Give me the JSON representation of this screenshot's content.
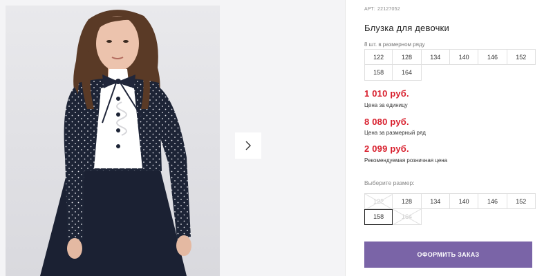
{
  "product": {
    "sku_label": "АРТ:",
    "sku": "22127052",
    "title": "Блузка для девочки",
    "pack_note": "8 шт. в размерном ряду"
  },
  "size_range": [
    "122",
    "128",
    "134",
    "140",
    "146",
    "152",
    "158",
    "164"
  ],
  "prices": {
    "unit_price": "1 010 руб.",
    "unit_label": "Цена за единицу",
    "range_price": "8 080 руб.",
    "range_label": "Цена за размерный ряд",
    "retail_price": "2 099 руб.",
    "retail_label": "Рекомендуемая розничная цена"
  },
  "size_picker": {
    "label": "Выберите размер:",
    "options": [
      {
        "size": "122",
        "available": false,
        "selected": false
      },
      {
        "size": "128",
        "available": true,
        "selected": false
      },
      {
        "size": "134",
        "available": true,
        "selected": false
      },
      {
        "size": "140",
        "available": true,
        "selected": false
      },
      {
        "size": "146",
        "available": true,
        "selected": false
      },
      {
        "size": "152",
        "available": true,
        "selected": false
      },
      {
        "size": "158",
        "available": true,
        "selected": true
      },
      {
        "size": "164",
        "available": false,
        "selected": false
      }
    ]
  },
  "order_button": "ОФОРМИТЬ ЗАКАЗ",
  "colors": {
    "price": "#d81e2c",
    "button": "#7a64a7",
    "dress": "#1d2436"
  },
  "icons": {
    "next": "chevron-right-icon"
  }
}
